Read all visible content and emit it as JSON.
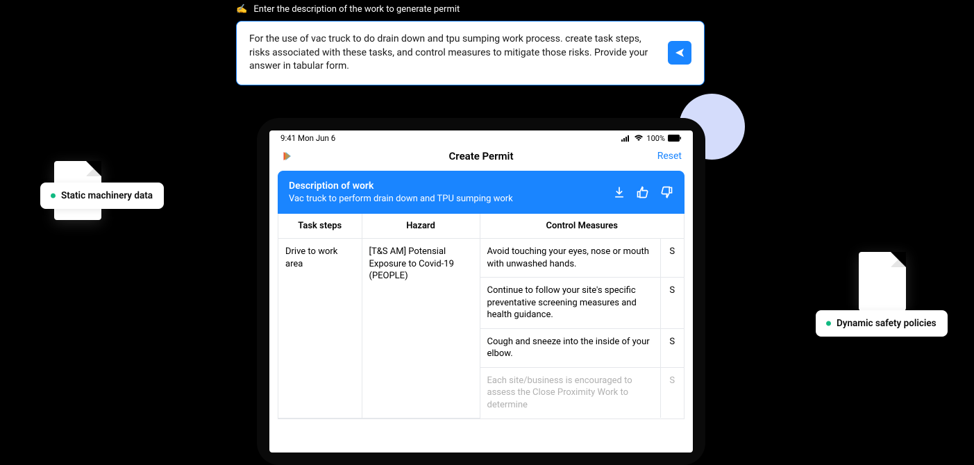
{
  "prompt": {
    "label": "Enter the description of the work to generate permit",
    "text": "For the use of vac truck to do drain down and tpu sumping work process. create task steps, risks associated with these tasks, and control measures to mitigate those risks. Provide your answer in tabular form."
  },
  "pills": {
    "left": "Static machinery data",
    "right": "Dynamic safety policies"
  },
  "tablet": {
    "status": {
      "time_date": "9:41  Mon Jun 6",
      "battery": "100%"
    },
    "header": {
      "title": "Create Permit",
      "reset": "Reset"
    },
    "card": {
      "title": "Description of work",
      "subtitle": "Vac truck to perform drain down and TPU sumping work"
    },
    "table": {
      "headers": [
        "Task steps",
        "Hazard",
        "Control Measures"
      ],
      "task_step": "Drive to work area",
      "hazard": "[T&S AM] Potensial Exposure to Covid-19 (PEOPLE)",
      "controls": [
        {
          "text": "Avoid touching your eyes, nose or mouth with unwashed hands.",
          "s": "S"
        },
        {
          "text": "Continue to follow your site's specific preventative screening measures and health guidance.",
          "s": "S"
        },
        {
          "text": "Cough and sneeze into the inside of your elbow.",
          "s": "S"
        },
        {
          "text": "Each site/business is encouraged to assess the Close Proximity Work to determine",
          "s": "S"
        }
      ]
    }
  }
}
